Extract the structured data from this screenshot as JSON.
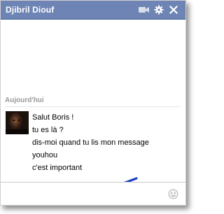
{
  "chat": {
    "title": "Djibril Diouf",
    "date_label": "Aujourd'hui",
    "messages": [
      "Salut Boris !",
      "tu es là ?",
      "dis-moi quand tu lis mon message",
      "youhou",
      "c'est important"
    ],
    "composer": {
      "value": "",
      "placeholder": ""
    },
    "icons": {
      "video": "video-camera-icon",
      "settings": "gear-icon",
      "close": "close-icon",
      "emoticon": "smiley-icon"
    }
  },
  "colors": {
    "titlebar": "#6d84b4",
    "titlebar_border": "#3b5998",
    "annotation_arrow": "#1a3fc8"
  }
}
